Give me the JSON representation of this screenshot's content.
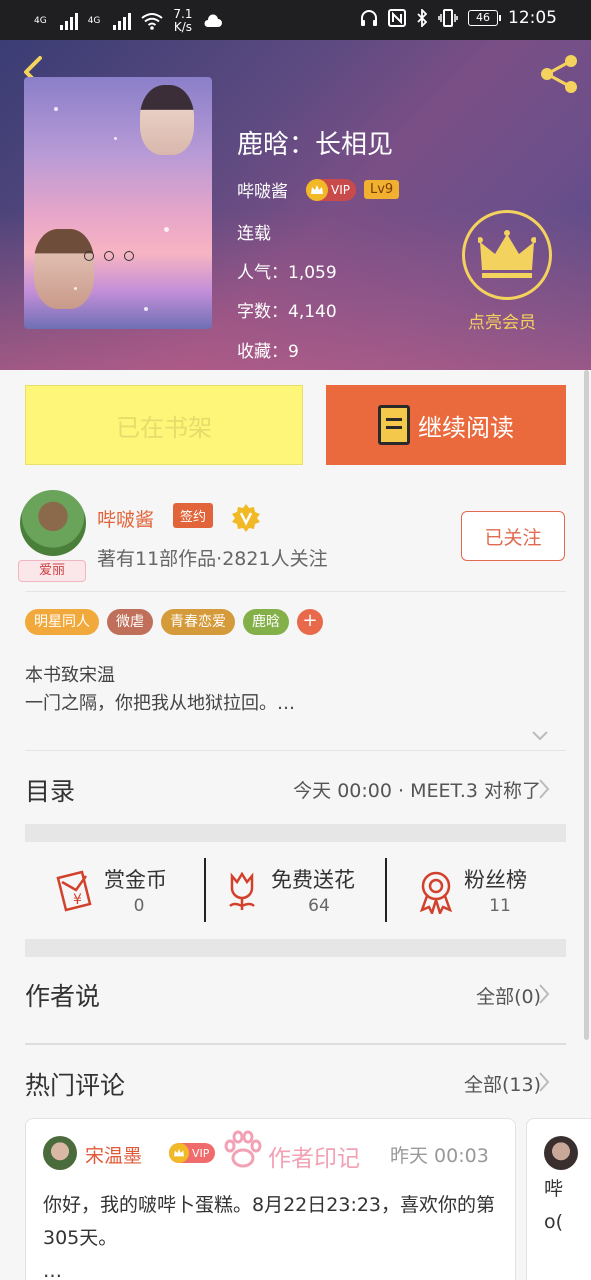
{
  "status": {
    "net1": "4G",
    "net2": "4G",
    "speed_value": "7.1",
    "speed_unit": "K/s",
    "battery": "46",
    "time": "12:05"
  },
  "book": {
    "title": "鹿晗：长相见",
    "author": "哔啵酱",
    "vip_label": "VIP",
    "level": "Lv9",
    "status": "连载",
    "popularity_label": "人气：",
    "popularity": "1,059",
    "words_label": "字数：",
    "words": "4,140",
    "favorites_label": "收藏：",
    "favorites": "9",
    "member_label": "点亮会员"
  },
  "actions": {
    "shelf_label": "已在书架",
    "read_label": "继续阅读"
  },
  "author": {
    "name": "哔啵酱",
    "signed_label": "签约",
    "avatar_tag": "爱丽",
    "stats": "著有11部作品·2821人关注",
    "follow_label": "已关注"
  },
  "tags": [
    {
      "label": "明星同人",
      "color": "#f2a93b"
    },
    {
      "label": "微虐",
      "color": "#c0705a"
    },
    {
      "label": "青春恋爱",
      "color": "#d59a3a"
    },
    {
      "label": "鹿晗",
      "color": "#84b04a"
    }
  ],
  "intro": {
    "line1": "本书致宋温",
    "line2": "一门之隔，你把我从地狱拉回。…"
  },
  "catalog": {
    "title": "目录",
    "latest": "今天 00:00 · MEET.3 对称了"
  },
  "stats": {
    "reward_label": "赏金币",
    "reward_value": "0",
    "flower_label": "免费送花",
    "flower_value": "64",
    "fans_label": "粉丝榜",
    "fans_value": "11"
  },
  "author_says": {
    "title": "作者说",
    "all_label": "全部(0)"
  },
  "hot_comments": {
    "title": "热门评论",
    "all_label": "全部(13)",
    "comments": [
      {
        "user": "宋温墨",
        "vip_label": "VIP",
        "stamp": "作者印记",
        "time": "昨天 00:03",
        "text": "你好，我的啵哔卜蛋糕。8月22日23:23，喜欢你的第305天。",
        "more": "…"
      }
    ],
    "next_preview_line1": "哔",
    "next_preview_line2": "o("
  },
  "colors": {
    "accent": "#ea6a3d",
    "shelf_button": "#fdf679",
    "gold": "#f3d35d"
  }
}
